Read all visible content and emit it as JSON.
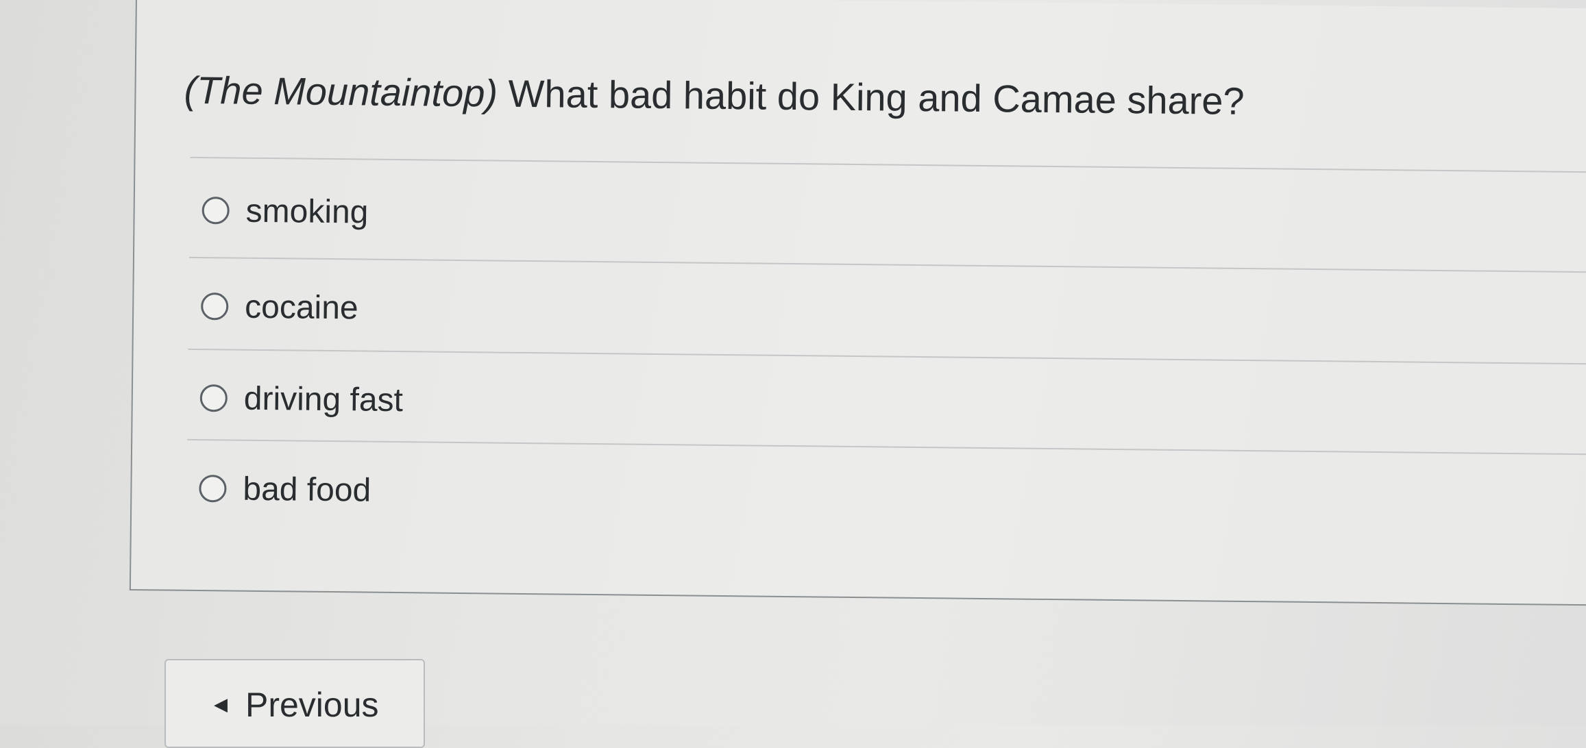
{
  "question": {
    "title_part": "(The Mountaintop)",
    "prompt": "What bad habit do King and Camae share?"
  },
  "answers": [
    {
      "label": "smoking",
      "selected": false
    },
    {
      "label": "cocaine",
      "selected": false
    },
    {
      "label": "driving fast",
      "selected": false
    },
    {
      "label": "bad food",
      "selected": false
    }
  ],
  "navigation": {
    "previous_label": "Previous",
    "previous_icon": "caret-left-icon"
  }
}
